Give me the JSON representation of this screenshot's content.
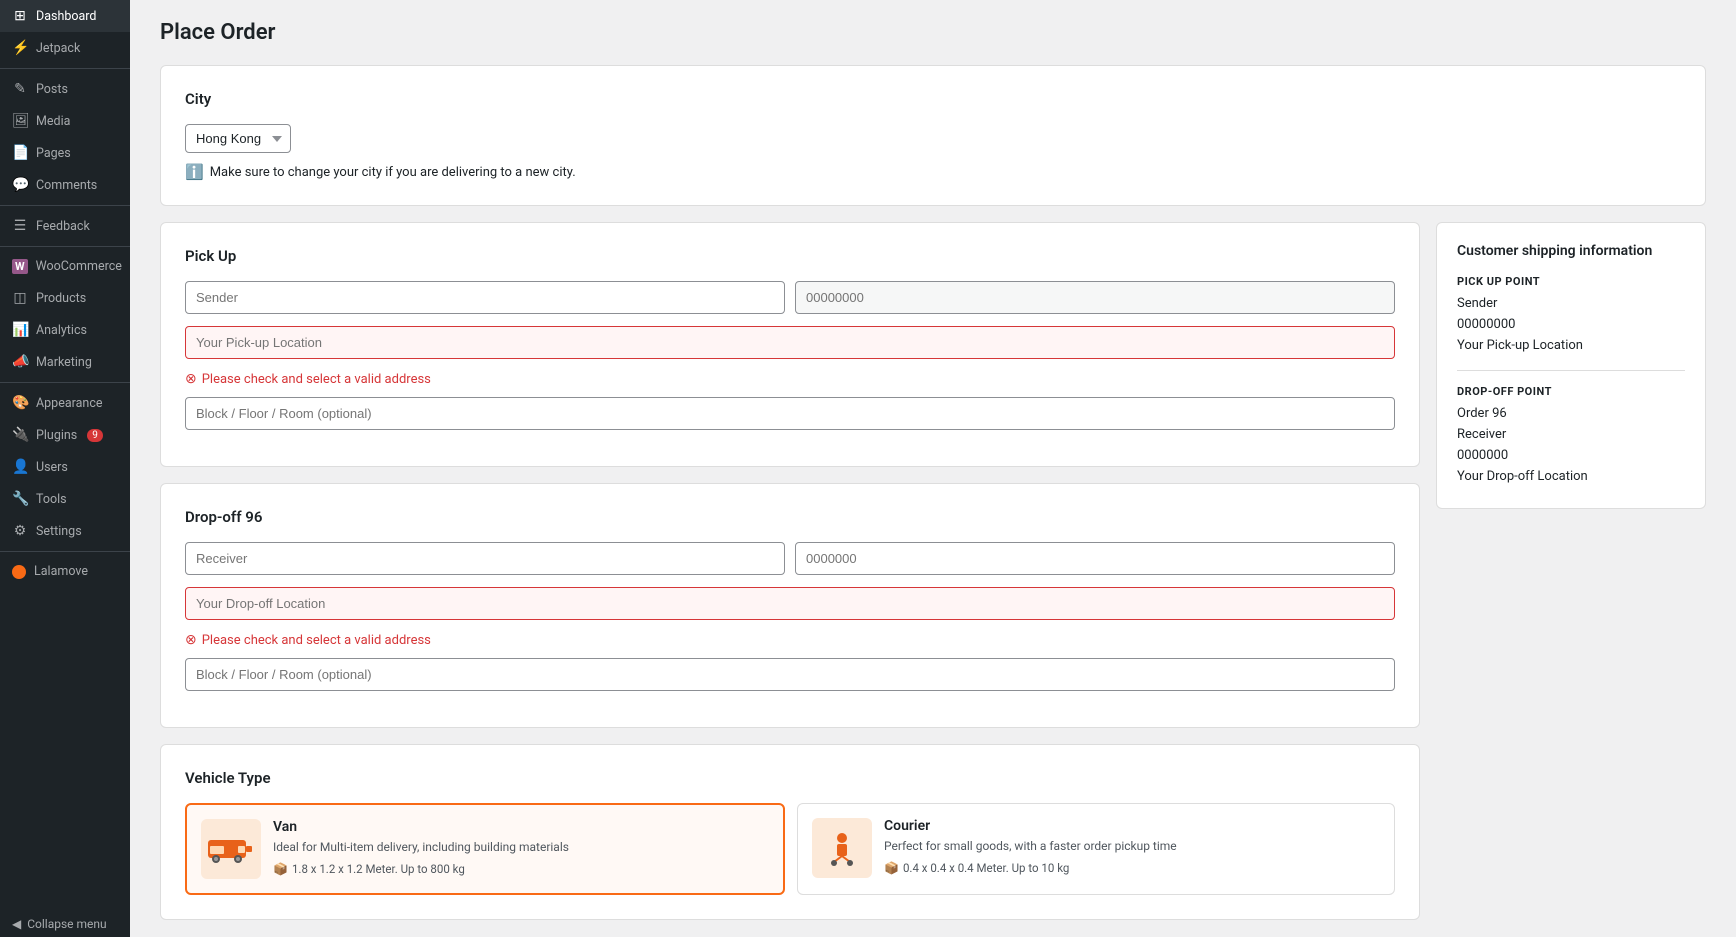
{
  "sidebar": {
    "items": [
      {
        "id": "dashboard",
        "label": "Dashboard",
        "icon": "⊞",
        "badge": null
      },
      {
        "id": "jetpack",
        "label": "Jetpack",
        "icon": "⚡",
        "badge": null
      },
      {
        "id": "posts",
        "label": "Posts",
        "icon": "✎",
        "badge": null
      },
      {
        "id": "media",
        "label": "Media",
        "icon": "🖼",
        "badge": null
      },
      {
        "id": "pages",
        "label": "Pages",
        "icon": "📄",
        "badge": null
      },
      {
        "id": "comments",
        "label": "Comments",
        "icon": "💬",
        "badge": null
      },
      {
        "id": "feedback",
        "label": "Feedback",
        "icon": "☰",
        "badge": null
      },
      {
        "id": "woocommerce",
        "label": "WooCommerce",
        "icon": "W",
        "badge": null
      },
      {
        "id": "products",
        "label": "Products",
        "icon": "◫",
        "badge": null
      },
      {
        "id": "analytics",
        "label": "Analytics",
        "icon": "📊",
        "badge": null
      },
      {
        "id": "marketing",
        "label": "Marketing",
        "icon": "📣",
        "badge": null
      },
      {
        "id": "appearance",
        "label": "Appearance",
        "icon": "🎨",
        "badge": null
      },
      {
        "id": "plugins",
        "label": "Plugins",
        "icon": "🔌",
        "badge": "9"
      },
      {
        "id": "users",
        "label": "Users",
        "icon": "👤",
        "badge": null
      },
      {
        "id": "tools",
        "label": "Tools",
        "icon": "🔧",
        "badge": null
      },
      {
        "id": "settings",
        "label": "Settings",
        "icon": "⚙",
        "badge": null
      }
    ],
    "lalamove_label": "Lalamove",
    "collapse_label": "Collapse menu"
  },
  "page": {
    "title": "Place Order"
  },
  "city_section": {
    "title": "City",
    "city_options": [
      "Hong Kong"
    ],
    "selected_city": "Hong Kong",
    "info_text": "Make sure to change your city if you are delivering to a new city."
  },
  "pickup_section": {
    "title": "Pick Up",
    "sender_placeholder": "Sender",
    "sender_value": "",
    "phone_placeholder": "00000000",
    "phone_value": "",
    "location_placeholder": "Your Pick-up Location",
    "location_value": "",
    "location_error": "Please check and select a valid address",
    "block_placeholder": "Block / Floor / Room (optional)",
    "block_value": ""
  },
  "dropoff_section": {
    "title": "Drop-off 96",
    "receiver_placeholder": "Receiver",
    "receiver_value": "",
    "phone_placeholder": "0000000",
    "phone_value": "",
    "location_placeholder": "Your Drop-off Location",
    "location_value": "",
    "location_error": "Please check and select a valid address",
    "block_placeholder": "Block / Floor / Room (optional)",
    "block_value": ""
  },
  "vehicle_section": {
    "title": "Vehicle Type",
    "vehicles": [
      {
        "id": "van",
        "name": "Van",
        "description": "Ideal for Multi-item delivery, including building materials",
        "specs": "1.8 x 1.2 x 1.2 Meter. Up to 800 kg",
        "selected": true
      },
      {
        "id": "courier",
        "name": "Courier",
        "description": "Perfect for small goods, with a faster order pickup time",
        "specs": "0.4 x 0.4 x 0.4 Meter. Up to 10 kg",
        "selected": false
      }
    ]
  },
  "shipping_info": {
    "title": "Customer shipping information",
    "pickup_label": "PICK UP POINT",
    "pickup_details": [
      "Sender",
      "00000000",
      "Your Pick-up Location"
    ],
    "dropoff_label": "DROP-OFF POINT",
    "dropoff_details": [
      "Order 96",
      "Receiver",
      "0000000",
      "Your Drop-off Location"
    ]
  }
}
